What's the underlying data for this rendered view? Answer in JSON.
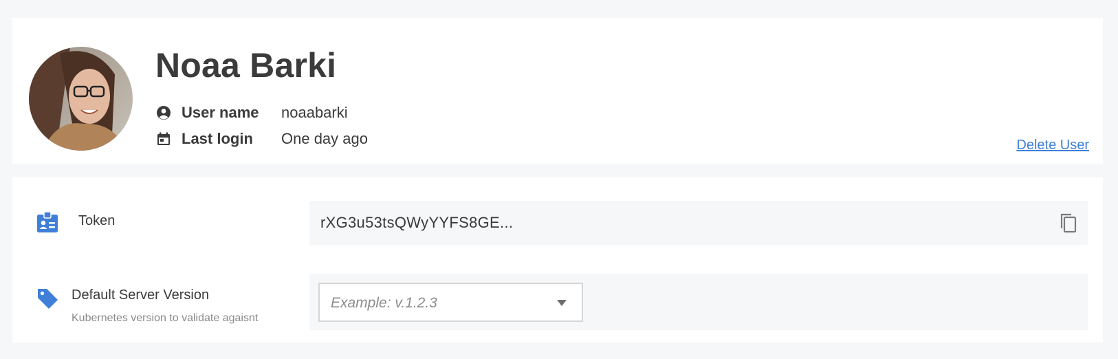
{
  "profile": {
    "full_name": "Noaa Barki",
    "username_label": "User name",
    "username_value": "noaabarki",
    "last_login_label": "Last login",
    "last_login_value": "One day ago",
    "delete_label": "Delete User",
    "avatar_icon": "avatar-photo",
    "username_icon": "account-circle-icon",
    "last_login_icon": "calendar-icon"
  },
  "settings": {
    "token": {
      "label": "Token",
      "value": "rXG3u53tsQWyYYFS8GE...",
      "icon": "badge-id-icon",
      "copy_icon": "copy-icon"
    },
    "server_version": {
      "label": "Default Server Version",
      "description": "Kubernetes version to validate agaisnt",
      "placeholder": "Example: v.1.2.3",
      "icon": "tag-icon",
      "dropdown_icon": "caret-down-icon"
    }
  },
  "colors": {
    "background": "#f6f7f9",
    "card": "#ffffff",
    "accent": "#3f7fd8",
    "text": "#3a3a3a",
    "muted": "#8a8a8a"
  }
}
